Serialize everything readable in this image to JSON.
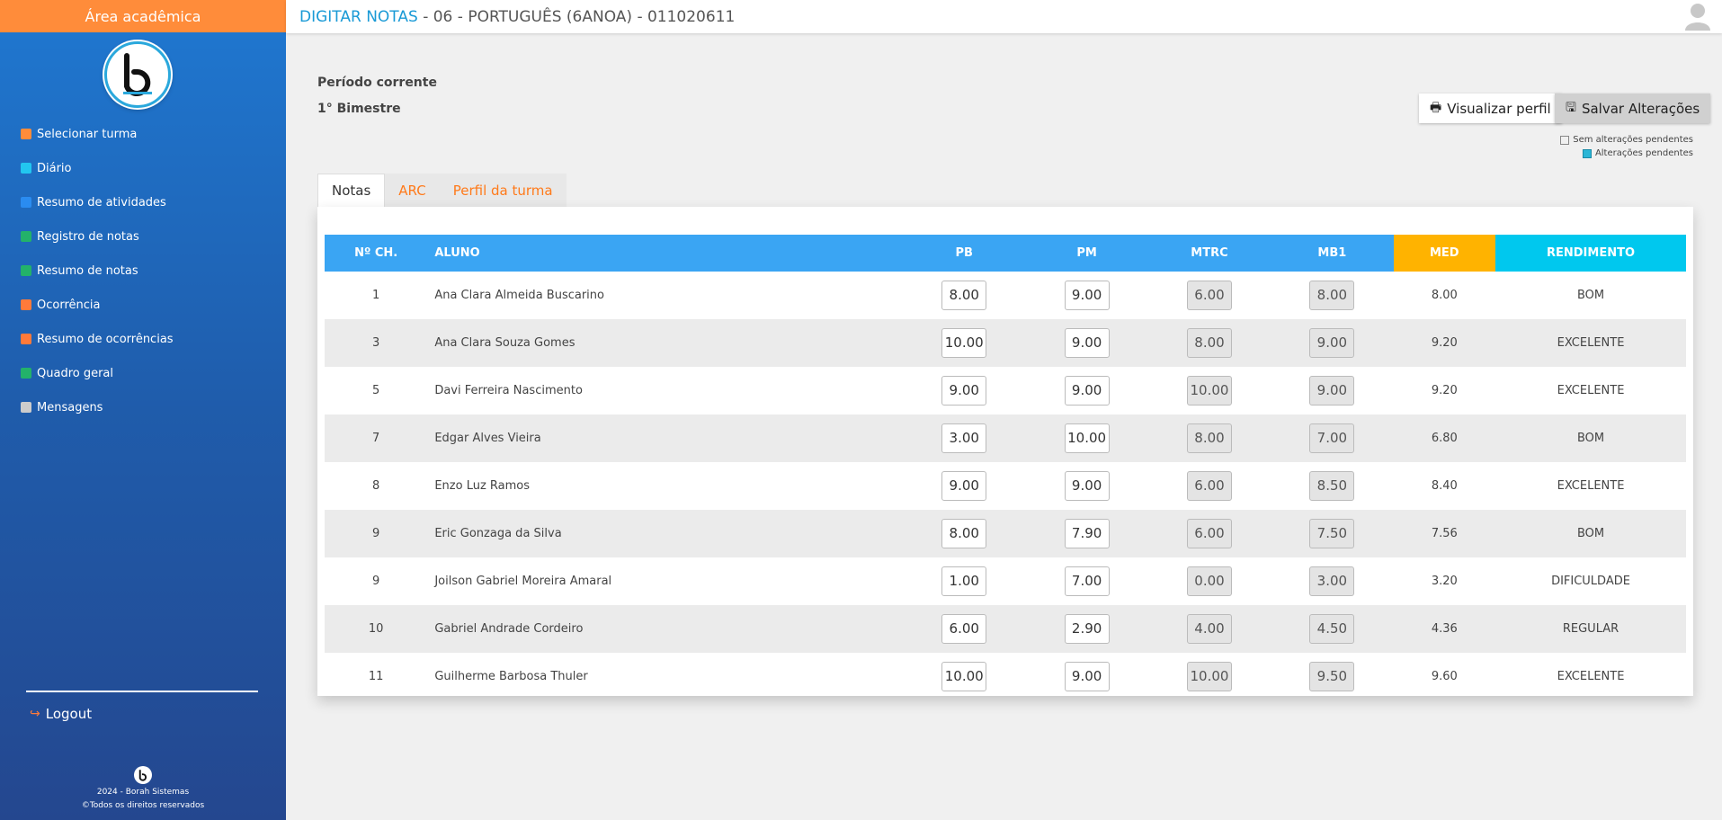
{
  "sidebar": {
    "header": "Área acadêmica",
    "items": [
      {
        "label": "Selecionar turma",
        "color": "#ff8c3a"
      },
      {
        "label": "Diário",
        "color": "#22c6f0"
      },
      {
        "label": "Resumo de atividades",
        "color": "#2a8cf0"
      },
      {
        "label": "Registro de notas",
        "color": "#23b26a"
      },
      {
        "label": "Resumo de notas",
        "color": "#23b26a"
      },
      {
        "label": "Ocorrência",
        "color": "#ff7a3a"
      },
      {
        "label": "Resumo de ocorrências",
        "color": "#ff7a3a"
      },
      {
        "label": "Quadro geral",
        "color": "#23b26a"
      },
      {
        "label": "Mensagens",
        "color": "#cccccc"
      }
    ],
    "logout": "Logout",
    "footer_line1": "2024 - Borah Sistemas",
    "footer_line2": "©Todos os direitos reservados"
  },
  "topbar": {
    "title_prefix": "DIGITAR NOTAS",
    "title_rest": " - 06 - PORTUGUÊS (6ANOA) - 011020611"
  },
  "period": {
    "label": "Período corrente",
    "value": "1° Bimestre"
  },
  "actions": {
    "view_profile": "Visualizar perfil",
    "save": "Salvar Alterações"
  },
  "legend": {
    "no_pending": "Sem alterações pendentes",
    "pending": "Alterações pendentes"
  },
  "tabs": [
    "Notas",
    "ARC",
    "Perfil da turma"
  ],
  "table": {
    "headers": [
      "Nº CH.",
      "ALUNO",
      "PB",
      "PM",
      "MTRC",
      "MB1",
      "MED",
      "RENDIMENTO"
    ],
    "rows": [
      {
        "num": "1",
        "name": "Ana Clara Almeida Buscarino",
        "pb": "8.00",
        "pm": "9.00",
        "mtrc": "6.00",
        "mb1": "8.00",
        "med": "8.00",
        "rend": "BOM",
        "rclass": "r-bom"
      },
      {
        "num": "3",
        "name": "Ana Clara Souza Gomes",
        "pb": "10.00",
        "pm": "9.00",
        "mtrc": "8.00",
        "mb1": "9.00",
        "med": "9.20",
        "rend": "EXCELENTE",
        "rclass": "r-exc"
      },
      {
        "num": "5",
        "name": "Davi Ferreira Nascimento",
        "pb": "9.00",
        "pm": "9.00",
        "mtrc": "10.00",
        "mb1": "9.00",
        "med": "9.20",
        "rend": "EXCELENTE",
        "rclass": "r-exc"
      },
      {
        "num": "7",
        "name": "Edgar Alves Vieira",
        "pb": "3.00",
        "pm": "10.00",
        "mtrc": "8.00",
        "mb1": "7.00",
        "med": "6.80",
        "rend": "BOM",
        "rclass": "r-bom"
      },
      {
        "num": "8",
        "name": "Enzo Luz Ramos",
        "pb": "9.00",
        "pm": "9.00",
        "mtrc": "6.00",
        "mb1": "8.50",
        "med": "8.40",
        "rend": "EXCELENTE",
        "rclass": "r-exc"
      },
      {
        "num": "9",
        "name": "Eric Gonzaga da Silva",
        "pb": "8.00",
        "pm": "7.90",
        "mtrc": "6.00",
        "mb1": "7.50",
        "med": "7.56",
        "rend": "BOM",
        "rclass": "r-bom"
      },
      {
        "num": "9",
        "name": "Joilson Gabriel Moreira Amaral",
        "pb": "1.00",
        "pm": "7.00",
        "mtrc": "0.00",
        "mb1": "3.00",
        "med": "3.20",
        "rend": "DIFICULDADE",
        "rclass": "r-dif"
      },
      {
        "num": "10",
        "name": "Gabriel Andrade Cordeiro",
        "pb": "6.00",
        "pm": "2.90",
        "mtrc": "4.00",
        "mb1": "4.50",
        "med": "4.36",
        "rend": "REGULAR",
        "rclass": "r-reg"
      },
      {
        "num": "11",
        "name": "Guilherme Barbosa Thuler",
        "pb": "10.00",
        "pm": "9.00",
        "mtrc": "10.00",
        "mb1": "9.50",
        "med": "9.60",
        "rend": "EXCELENTE",
        "rclass": "r-exc"
      }
    ]
  }
}
